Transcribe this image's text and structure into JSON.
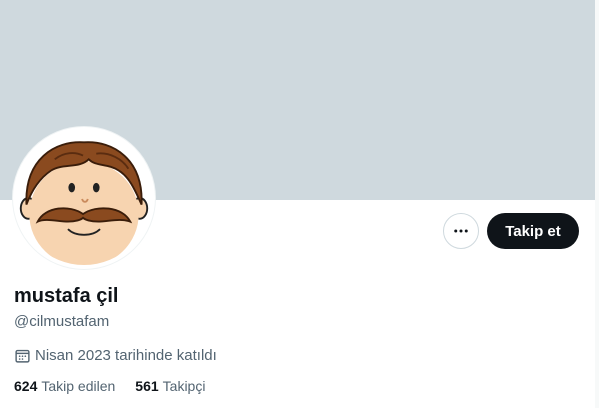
{
  "profile": {
    "display_name": "mustafa çil",
    "handle": "@cilmustafam",
    "joined": "Nisan 2023 tarihinde katıldı",
    "following_count": "624",
    "following_label": "Takip edilen",
    "followers_count": "561",
    "followers_label": "Takipçi"
  },
  "actions": {
    "follow_label": "Takip et",
    "more_icon": "more-horizontal-icon"
  },
  "icons": {
    "joined": "calendar-icon"
  },
  "colors": {
    "banner": "#cfd9de",
    "primary_text": "#0f1419",
    "secondary_text": "#536471",
    "follow_button": "#0f1419"
  }
}
